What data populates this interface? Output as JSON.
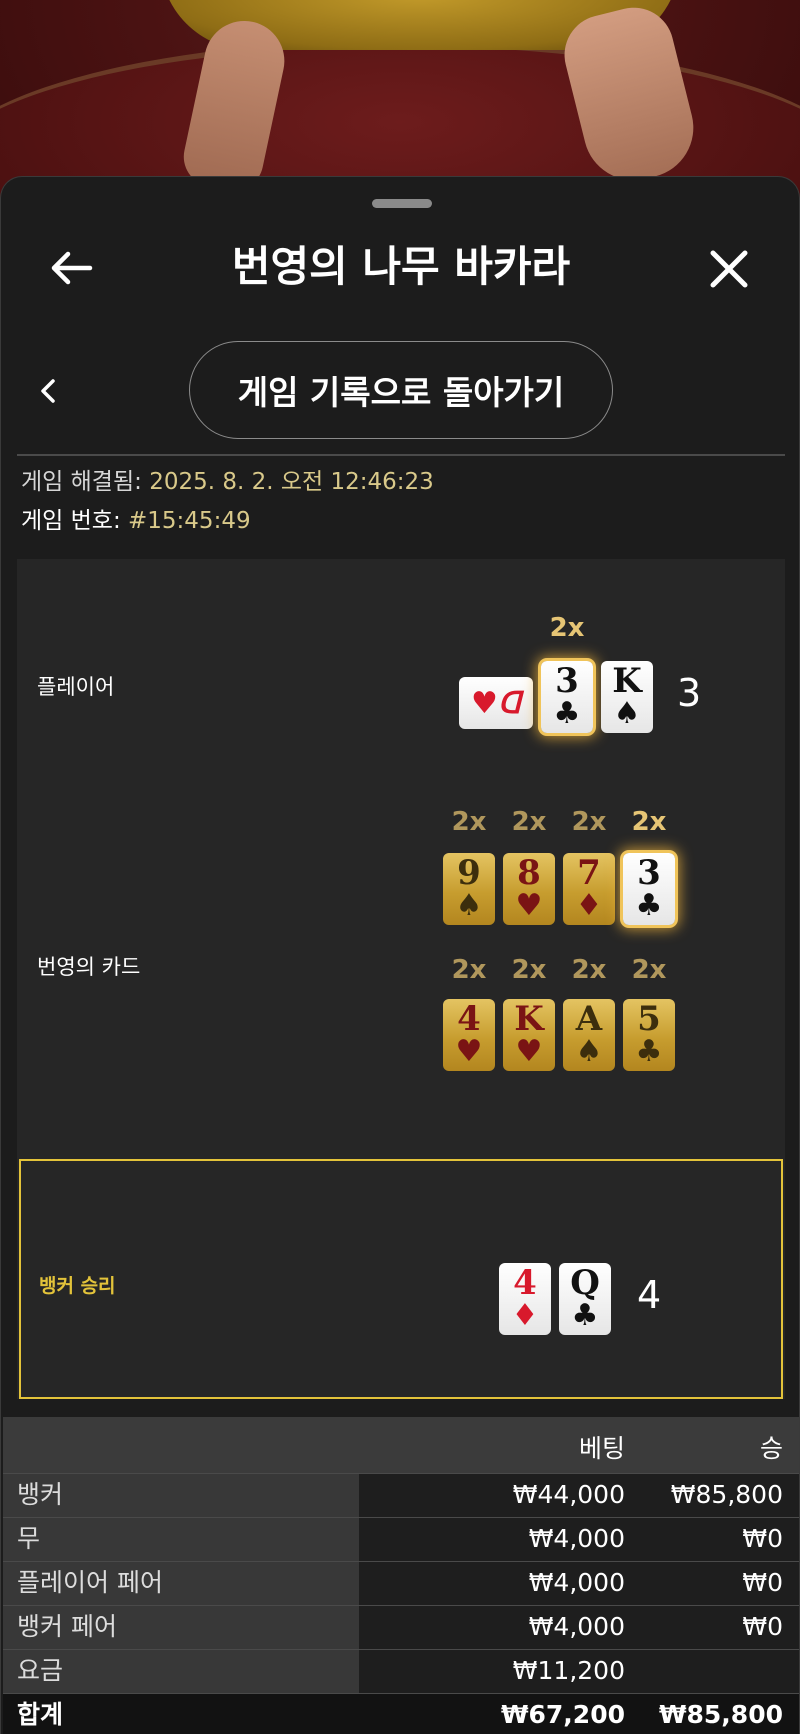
{
  "header": {
    "title": "번영의 나무 바카라"
  },
  "nav": {
    "back_to_history_label": "게임 기록으로 돌아가기"
  },
  "meta": {
    "resolved_label": "게임 해결됨:",
    "resolved_value": "2025. 8. 2. 오전 12:46:23",
    "game_number_label": "게임 번호:",
    "game_number_value": "#15:45:49"
  },
  "result": {
    "player": {
      "label": "플레이어",
      "multiplier": "2x",
      "cards": [
        {
          "rank": "",
          "suit": "♥",
          "face": "back",
          "color": "red"
        },
        {
          "rank": "3",
          "suit": "♣",
          "color": "black"
        },
        {
          "rank": "K",
          "suit": "♠",
          "color": "black"
        }
      ],
      "total": "3"
    },
    "fortune_cards": {
      "label": "번영의 카드",
      "row1": [
        {
          "multiplier": "2x",
          "rank": "9",
          "suit": "♠",
          "color": "black"
        },
        {
          "multiplier": "2x",
          "rank": "8",
          "suit": "♥",
          "color": "red"
        },
        {
          "multiplier": "2x",
          "rank": "7",
          "suit": "♦",
          "color": "red"
        },
        {
          "multiplier": "2x",
          "rank": "3",
          "suit": "♣",
          "color": "black"
        }
      ],
      "row2": [
        {
          "multiplier": "2x",
          "rank": "4",
          "suit": "♥",
          "color": "red"
        },
        {
          "multiplier": "2x",
          "rank": "K",
          "suit": "♥",
          "color": "red"
        },
        {
          "multiplier": "2x",
          "rank": "A",
          "suit": "♠",
          "color": "black"
        },
        {
          "multiplier": "2x",
          "rank": "5",
          "suit": "♣",
          "color": "black"
        }
      ]
    },
    "banker": {
      "label": "뱅커 승리",
      "cards": [
        {
          "rank": "4",
          "suit": "♦",
          "color": "red"
        },
        {
          "rank": "Q",
          "suit": "♣",
          "color": "black"
        }
      ],
      "total": "4"
    },
    "colors": {
      "winner_accent": "#e3c33a",
      "multiplier_gold": "#e6c575"
    }
  },
  "bets": {
    "headers": {
      "bet": "베팅",
      "win": "승"
    },
    "rows": [
      {
        "name": "뱅커",
        "bet": "₩44,000",
        "win": "₩85,800"
      },
      {
        "name": "무",
        "bet": "₩4,000",
        "win": "₩0"
      },
      {
        "name": "플레이어 페어",
        "bet": "₩4,000",
        "win": "₩0"
      },
      {
        "name": "뱅커 페어",
        "bet": "₩4,000",
        "win": "₩0"
      },
      {
        "name": "요금",
        "bet": "₩11,200",
        "win": ""
      }
    ],
    "total": {
      "name": "합계",
      "bet": "₩67,200",
      "win": "₩85,800"
    }
  },
  "icons": {
    "back": "arrow-left-icon",
    "close": "close-icon",
    "chevron": "chevron-left-icon"
  }
}
